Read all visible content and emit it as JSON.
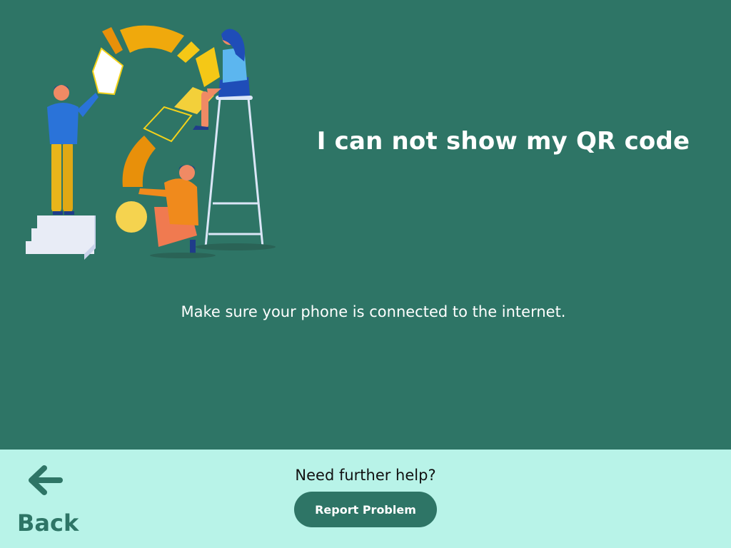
{
  "main": {
    "title": "I can not show my QR code",
    "message": "Make sure your phone is connected to the internet.",
    "illustration": {
      "icon": "question-mark-team-illustration"
    }
  },
  "footer": {
    "back": {
      "label": "Back",
      "icon": "arrow-left-icon"
    },
    "help_text": "Need further help?",
    "report_label": "Report Problem"
  },
  "colors": {
    "background": "#2e7566",
    "footer_background": "#b8f3e8",
    "accent": "#2e7566",
    "text_light": "#ffffff",
    "text_dark": "#111111"
  }
}
